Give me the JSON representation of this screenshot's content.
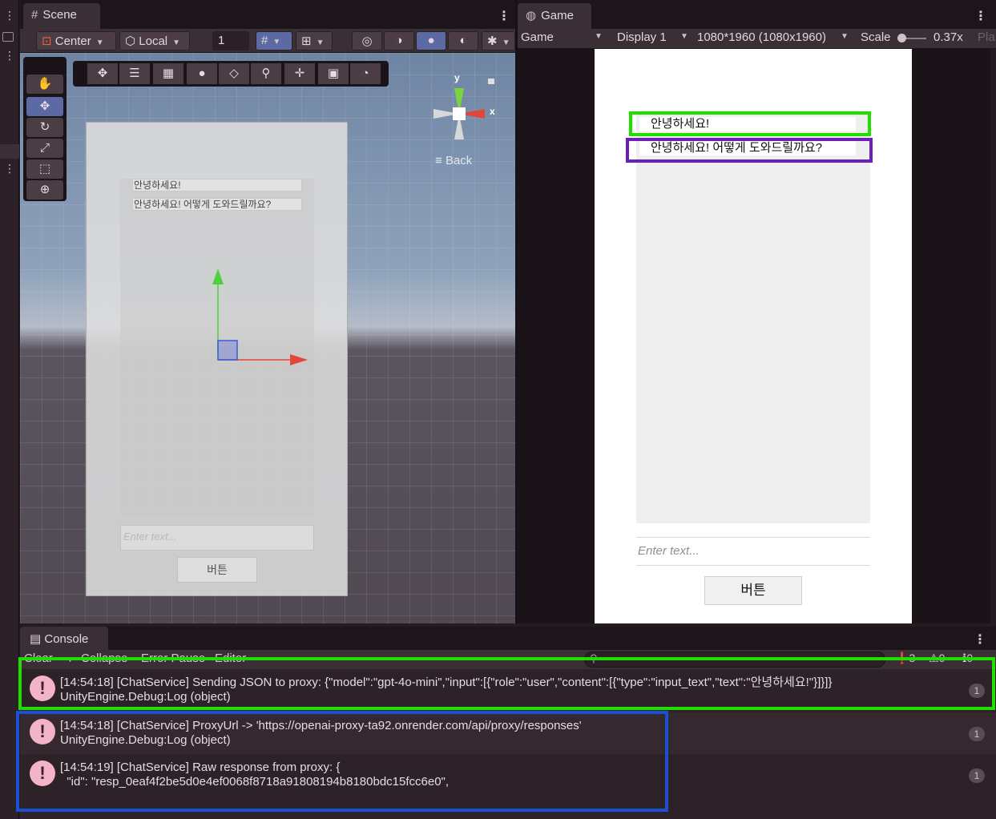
{
  "colors": {
    "green_box": "#22dd00",
    "purple_box": "#6a1fb8",
    "blue_box": "#1a4fd6",
    "accent_selected": "#5c6aa3"
  },
  "scene": {
    "tab_label": "Scene",
    "pivot_label": "Center",
    "space_label": "Local",
    "grid_value": "1",
    "orientation_back": "Back",
    "axis_y": "y",
    "axis_x": "x",
    "canvas": {
      "message_1": "안녕하세요!",
      "message_2": "안녕하세요! 어떻게 도와드릴까요?",
      "input_placeholder": "Enter text...",
      "button_label": "버튼"
    }
  },
  "game": {
    "tab_label": "Game",
    "mode_label": "Game",
    "display_label": "Display 1",
    "resolution_label": "1080*1960 (1080x1960)",
    "scale_label": "Scale",
    "scale_value": "0.37x",
    "play_focus_label": "Pla",
    "chat": {
      "message_1": "안녕하세요!",
      "message_2": "안녕하세요! 어떻게 도와드릴까요?",
      "input_placeholder": "Enter text...",
      "button_label": "버튼"
    }
  },
  "console": {
    "tab_label": "Console",
    "toolbar": {
      "clear": "Clear",
      "collapse": "Collapse",
      "error_pause": "Error Pause",
      "editor": "Editor"
    },
    "counts": {
      "errors": "3",
      "warnings": "0",
      "messages": "0"
    },
    "logs": [
      {
        "line1": "[14:54:18] [ChatService] Sending JSON to proxy: {\"model\":\"gpt-4o-mini\",\"input\":[{\"role\":\"user\",\"content\":[{\"type\":\"input_text\",\"text\":\"안녕하세요!\"}]}]}",
        "line2": "UnityEngine.Debug:Log (object)",
        "count": "1"
      },
      {
        "line1": "[14:54:18] [ChatService] ProxyUrl -> 'https://openai-proxy-ta92.onrender.com/api/proxy/responses'",
        "line2": "UnityEngine.Debug:Log (object)",
        "count": "1"
      },
      {
        "line1": "[14:54:19] [ChatService] Raw response from proxy: {",
        "line2": "  \"id\": \"resp_0eaf4f2be5d0e4ef0068f8718a91808194b8180bdc15fcc6e0\",",
        "count": "1"
      }
    ]
  }
}
